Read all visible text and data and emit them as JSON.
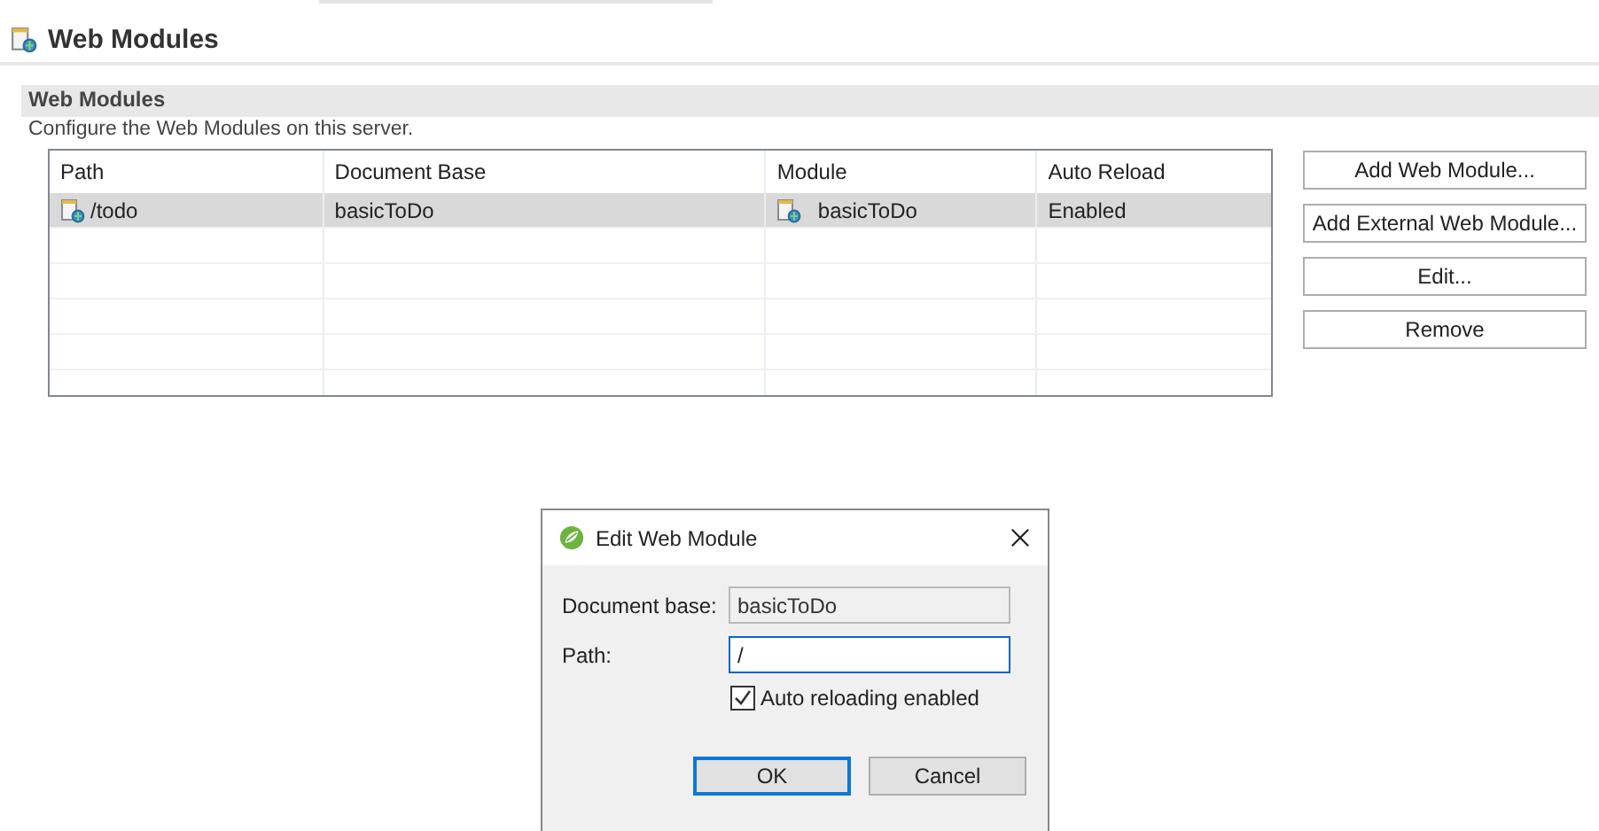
{
  "editor": {
    "title": "Web Modules"
  },
  "section": {
    "title": "Web Modules",
    "description": "Configure the Web Modules on this server."
  },
  "table": {
    "columns": [
      "Path",
      "Document Base",
      "Module",
      "Auto Reload"
    ],
    "rows": [
      {
        "path": "/todo",
        "document_base": "basicToDo",
        "module": "basicToDo",
        "auto_reload": "Enabled",
        "selected": true
      }
    ]
  },
  "buttons": [
    "Add Web Module...",
    "Add External Web Module...",
    "Edit...",
    "Remove"
  ],
  "dialog": {
    "title": "Edit Web Module",
    "fields": [
      {
        "label": "Document base:",
        "value": "basicToDo",
        "disabled": true
      },
      {
        "label": "Path:",
        "value": "/",
        "disabled": false
      }
    ],
    "checkbox": {
      "label": "Auto reloading enabled",
      "checked": true
    },
    "buttons": [
      {
        "label": "OK",
        "default": true
      },
      {
        "label": "Cancel",
        "default": false
      }
    ]
  }
}
